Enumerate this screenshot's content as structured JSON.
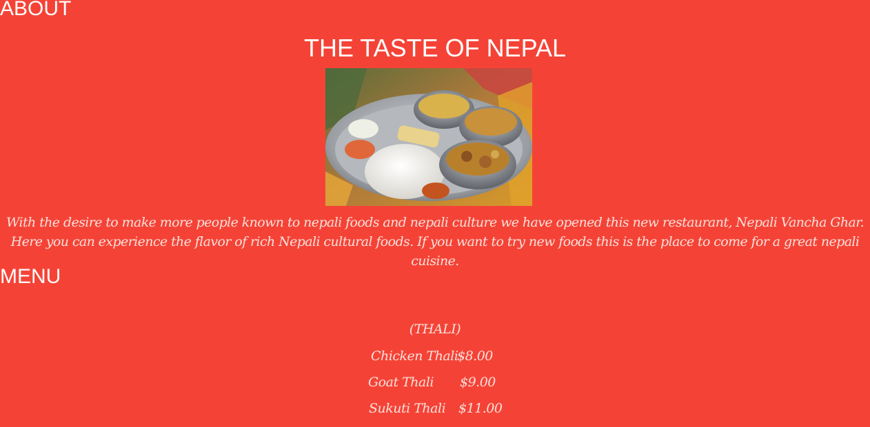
{
  "about": {
    "heading": "ABOUT",
    "title": "THE TASTE OF NEPAL",
    "image_alt": "Nepali thali plate with rice, dal and curries",
    "description": "With the desire to make more people known to nepali foods and nepali culture we have opened this new restaurant, Nepali Vancha Ghar. Here you can experience the flavor of rich Nepali cultural foods. If you want to try new foods this is the place to come for a great nepali cuisine."
  },
  "menu": {
    "heading": "MENU",
    "category": "(THALI)",
    "items": [
      {
        "name": "Chicken Thali",
        "price": "$8.00"
      },
      {
        "name": "Goat Thali",
        "price": "$9.00"
      },
      {
        "name": "Sukuti Thali",
        "price": "$11.00"
      }
    ]
  },
  "colors": {
    "background": "#f44336",
    "heading_text": "#ffffff",
    "body_text": "#fbe0dc"
  }
}
